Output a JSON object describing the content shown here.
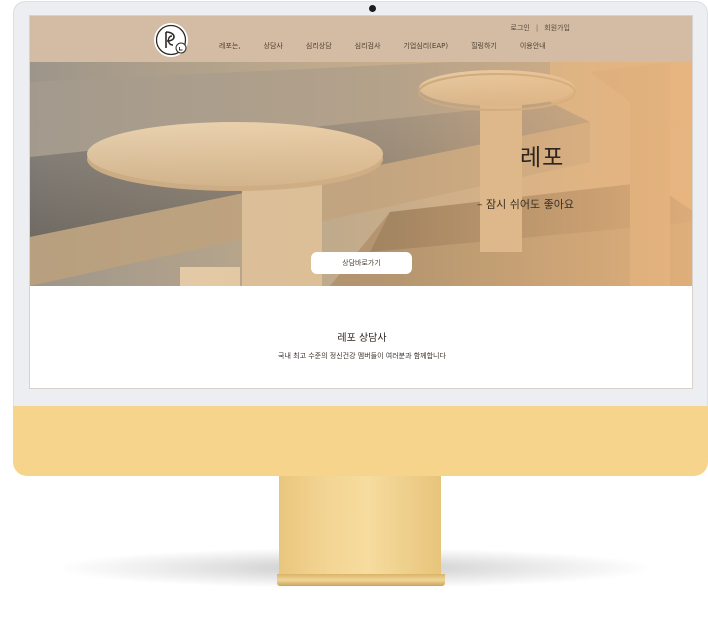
{
  "header": {
    "util_links": [
      "로그인",
      "회원가입"
    ],
    "nav_items": [
      "레포는,",
      "상담사",
      "심리상담",
      "심리검사",
      "기업심리(EAP)",
      "힐링하기",
      "이용안내"
    ]
  },
  "hero": {
    "title": "레포",
    "subtitle": "– 잠시 쉬어도 좋아요",
    "cta_label": "상담바로가기"
  },
  "section": {
    "title": "레포 상담사",
    "description": "국내 최고 수준의 정신건강 멤버들이 여러분과 함께합니다"
  },
  "colors": {
    "header_bg": "#d3bba4",
    "chin": "#f7d48c",
    "hero_tint": "#e9b982"
  }
}
